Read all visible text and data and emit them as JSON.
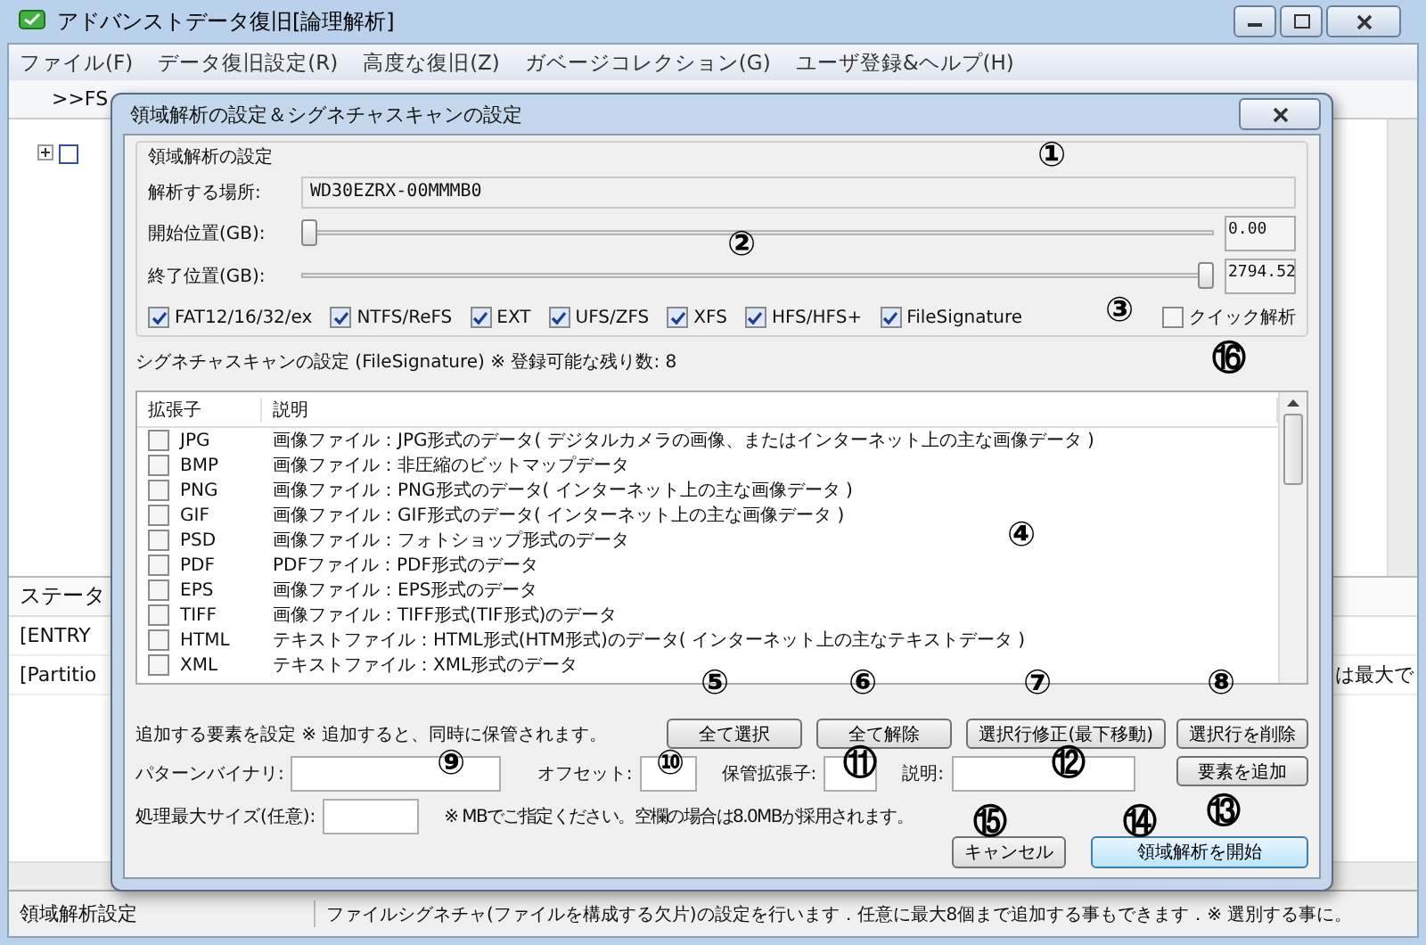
{
  "window": {
    "title": "アドバンストデータ復旧[論理解析]"
  },
  "menu": [
    "ファイル(F)",
    "データ復旧設定(R)",
    "高度な復旧(Z)",
    "ガベージコレクション(G)",
    "ユーザ登録&ヘルプ(H)"
  ],
  "toolbar": {
    "label": ">>FS"
  },
  "status_pane": {
    "header": "ステータ",
    "rows": [
      {
        "text": "[ENTRY"
      },
      {
        "text": "[Partitio",
        "tail": "は最大で"
      }
    ]
  },
  "status_bar": {
    "left": "領域解析設定",
    "message": "ファイルシグネチャ(ファイルを構成する欠片)の設定を行います．任意に最大8個まで追加する事もできます．※ 選別する事に。"
  },
  "dialog": {
    "title": "領域解析の設定＆シグネチャスキャンの設定",
    "region": {
      "legend": "領域解析の設定",
      "location_label": "解析する場所:",
      "location_value": "WD30EZRX-00MMMB0",
      "sliders": [
        {
          "label": "開始位置(GB):",
          "level": 0,
          "value": "0.00"
        },
        {
          "label": "終了位置(GB):",
          "level": 1,
          "value": "2794.52"
        }
      ],
      "filesystems": [
        {
          "label": "FAT12/16/32/ex",
          "checked": true
        },
        {
          "label": "NTFS/ReFS",
          "checked": true
        },
        {
          "label": "EXT",
          "checked": true
        },
        {
          "label": "UFS/ZFS",
          "checked": true
        },
        {
          "label": "XFS",
          "checked": true
        },
        {
          "label": "HFS/HFS+",
          "checked": true
        },
        {
          "label": "FileSignature",
          "checked": true
        }
      ],
      "quick": {
        "label": "クイック解析",
        "checked": false
      }
    },
    "signature": {
      "title": "シグネチャスキャンの設定 (FileSignature) ※ 登録可能な残り数: 8",
      "columns": [
        "拡張子",
        "説明"
      ],
      "rows": [
        {
          "ext": "JPG",
          "checked": false,
          "desc": "画像ファイル：JPG形式のデータ( デジタルカメラの画像、またはインターネット上の主な画像データ )"
        },
        {
          "ext": "BMP",
          "checked": false,
          "desc": "画像ファイル：非圧縮のビットマップデータ"
        },
        {
          "ext": "PNG",
          "checked": false,
          "desc": "画像ファイル：PNG形式のデータ( インターネット上の主な画像データ )"
        },
        {
          "ext": "GIF",
          "checked": false,
          "desc": "画像ファイル：GIF形式のデータ( インターネット上の主な画像データ )"
        },
        {
          "ext": "PSD",
          "checked": false,
          "desc": "画像ファイル：フォトショップ形式のデータ"
        },
        {
          "ext": "PDF",
          "checked": false,
          "desc": "PDFファイル：PDF形式のデータ"
        },
        {
          "ext": "EPS",
          "checked": false,
          "desc": "画像ファイル：EPS形式のデータ"
        },
        {
          "ext": "TIFF",
          "checked": false,
          "desc": "画像ファイル：TIFF形式(TIF形式)のデータ"
        },
        {
          "ext": "HTML",
          "checked": false,
          "desc": "テキストファイル：HTML形式(HTM形式)のデータ( インターネット上の主なテキストデータ )"
        },
        {
          "ext": "XML",
          "checked": false,
          "desc": "テキストファイル：XML形式のデータ"
        }
      ]
    },
    "list_buttons": [
      "全て選択",
      "全て解除",
      "選択行修正(最下移動)",
      "選択行を削除"
    ],
    "add_note": "追加する要素を設定 ※ 追加すると、同時に保管されます。",
    "fields": [
      {
        "label": "パターンバイナリ:"
      },
      {
        "label": "オフセット:"
      },
      {
        "label": "保管拡張子:"
      },
      {
        "label": "説明:"
      }
    ],
    "add_button": "要素を追加",
    "max_size": {
      "label": "処理最大サイズ(任意):",
      "note": "※ MBでご指定ください。空欄の場合は8.0MBが採用されます。"
    },
    "buttons": [
      {
        "label": "キャンセル",
        "default": false
      },
      {
        "label": "領域解析を開始",
        "default": true
      }
    ]
  },
  "annotations": [
    "①",
    "②",
    "③",
    "⑯",
    "④",
    "⑤",
    "⑥",
    "⑦",
    "⑧",
    "⑨",
    "⑩",
    "⑪",
    "⑫",
    "⑮",
    "⑭",
    "⑬"
  ]
}
